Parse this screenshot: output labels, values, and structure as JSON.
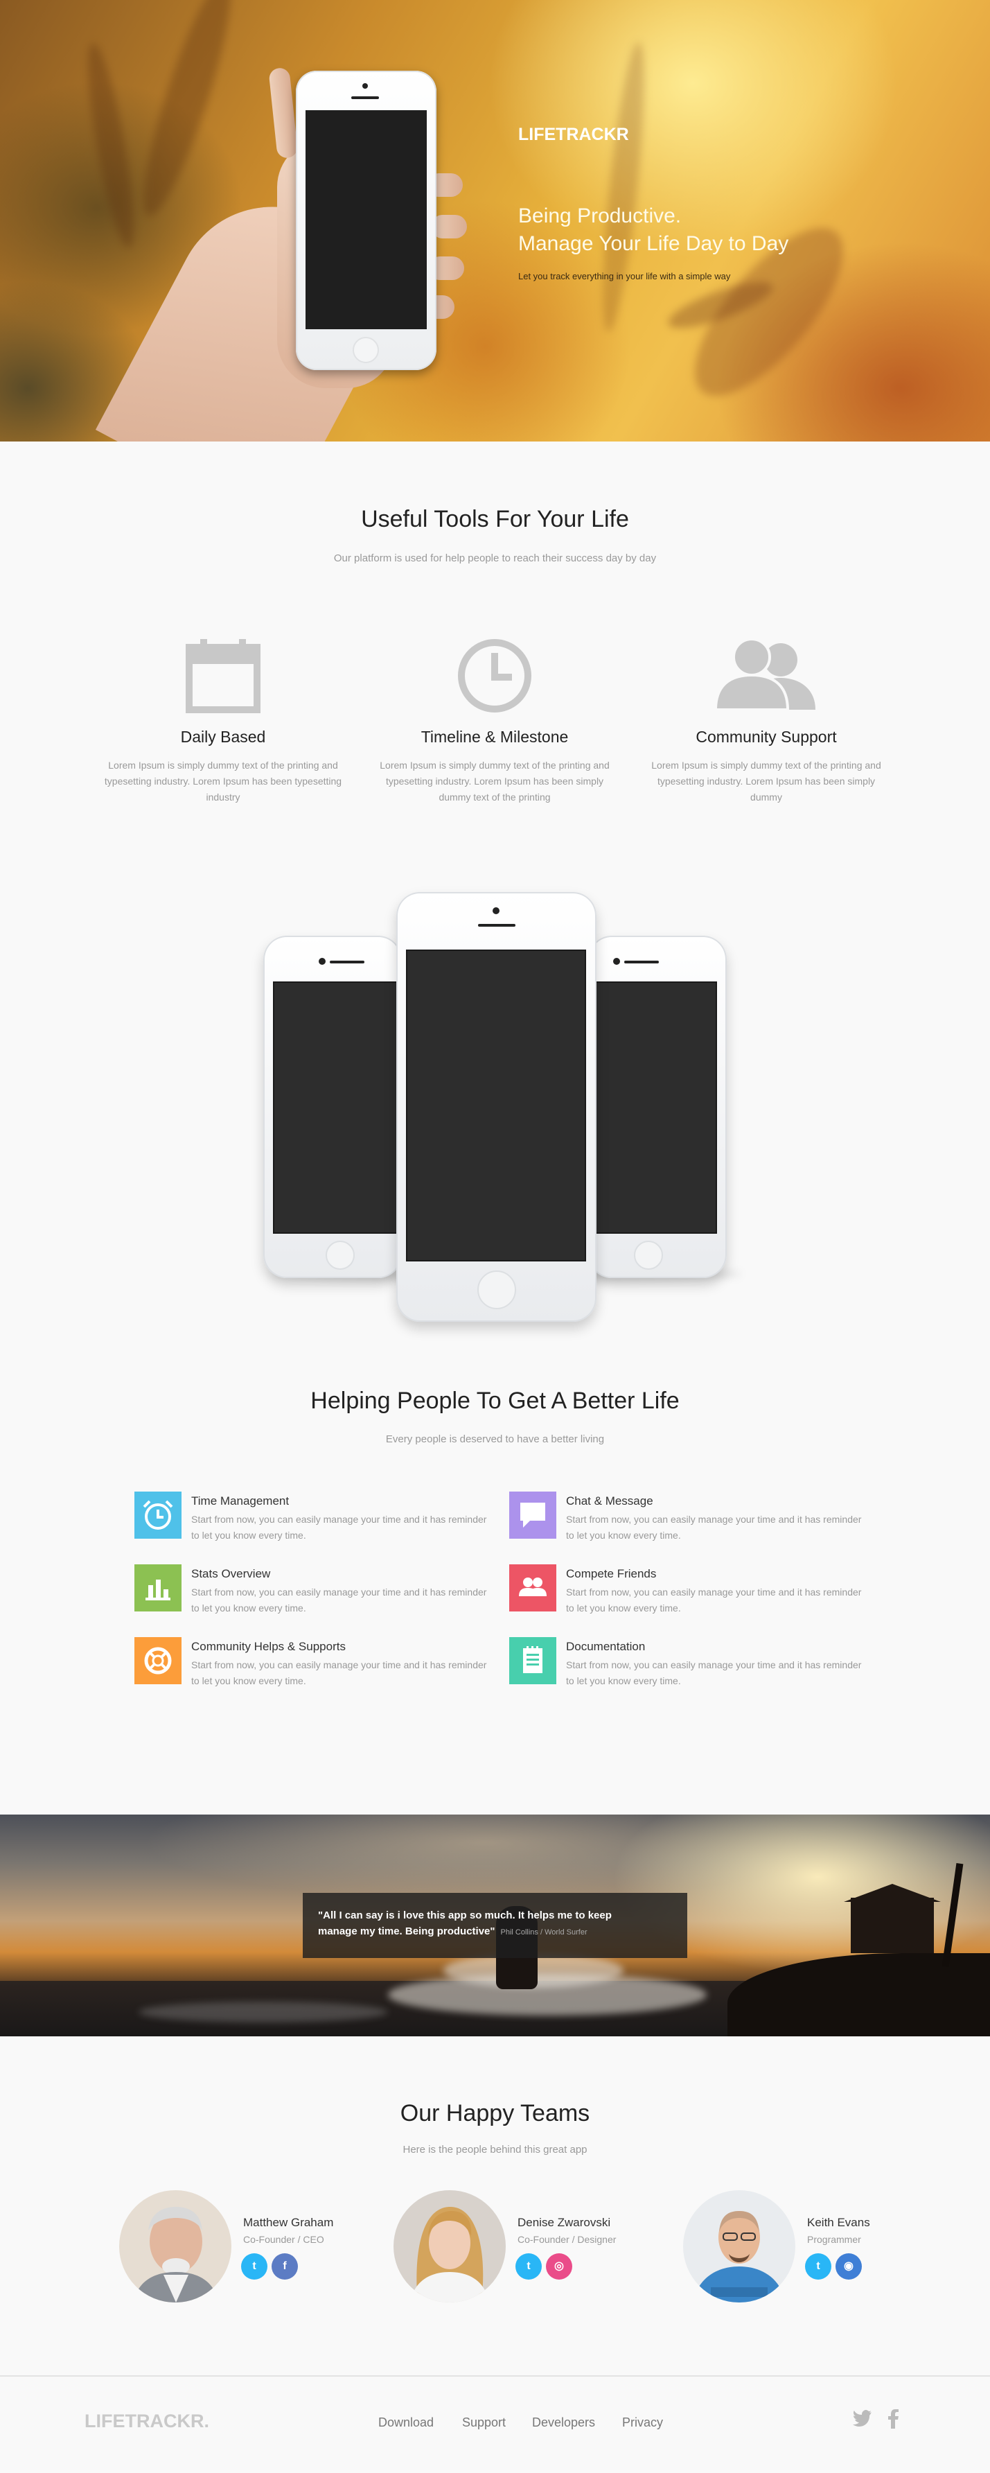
{
  "hero": {
    "logo": "LIFETRACKR",
    "headline_line1": "Being Productive.",
    "headline_line2": "Manage Your Life Day to Day",
    "subtext": "Let you track everything in your life with a simple way"
  },
  "tools": {
    "title": "Useful Tools For Your Life",
    "subtitle": "Our platform is used for help people to reach their success day by day",
    "items": [
      {
        "icon": "calendar-icon",
        "title": "Daily Based",
        "desc": "Lorem Ipsum is simply dummy text of the printing and typesetting industry. Lorem Ipsum has been typesetting industry"
      },
      {
        "icon": "clock-icon",
        "title": "Timeline & Milestone",
        "desc": "Lorem Ipsum is simply dummy text of the printing and typesetting industry. Lorem Ipsum has been simply dummy text of the printing"
      },
      {
        "icon": "users-icon",
        "title": "Community Support",
        "desc": "Lorem Ipsum is simply dummy text of the printing and typesetting industry. Lorem Ipsum has been simply dummy"
      }
    ]
  },
  "features": {
    "title": "Helping People To Get A Better Life",
    "subtitle": "Every people is deserved to have a better living",
    "items": [
      {
        "icon": "alarm-clock-icon",
        "color": "#4fc1e9",
        "title": "Time Management",
        "desc": "Start from now, you can easily manage your time and it has reminder to let you know every time."
      },
      {
        "icon": "chat-icon",
        "color": "#ac92ec",
        "title": "Chat & Message",
        "desc": "Start from now, you can easily manage your time and it has reminder to let you know every time."
      },
      {
        "icon": "bar-chart-icon",
        "color": "#8cc152",
        "title": "Stats Overview",
        "desc": "Start from now, you can easily manage your time and it has reminder to let you know every time."
      },
      {
        "icon": "friends-icon",
        "color": "#ed5565",
        "title": "Compete Friends",
        "desc": "Start from now, you can easily manage your time and it has reminder to let you know every time."
      },
      {
        "icon": "lifebuoy-icon",
        "color": "#fc9d3a",
        "title": "Community Helps & Supports",
        "desc": "Start from now, you can easily manage your time and it has reminder to let you know every time."
      },
      {
        "icon": "document-icon",
        "color": "#48cfad",
        "title": "Documentation",
        "desc": "Start from now, you can easily manage your time and it has reminder to let you know every time."
      }
    ]
  },
  "testimonial": {
    "quote_line1": "\"All I can say is i love this app so much. It helps me to keep",
    "quote_line2": "manage my time. Being productive\"",
    "author": "Phil Collins / World Surfer"
  },
  "team": {
    "title": "Our Happy Teams",
    "subtitle": "Here is the people behind this great app",
    "members": [
      {
        "name": "Matthew Graham",
        "role": "Co-Founder / CEO",
        "social": [
          {
            "icon": "twitter-icon",
            "color": "#29b6f6",
            "glyph": "t"
          },
          {
            "icon": "facebook-icon",
            "color": "#5c7cc4",
            "glyph": "f"
          }
        ]
      },
      {
        "name": "Denise Zwarovski",
        "role": "Co-Founder / Designer",
        "social": [
          {
            "icon": "twitter-icon",
            "color": "#29b6f6",
            "glyph": "t"
          },
          {
            "icon": "dribbble-icon",
            "color": "#ea4c89",
            "glyph": "◎"
          }
        ]
      },
      {
        "name": "Keith Evans",
        "role": "Programmer",
        "social": [
          {
            "icon": "twitter-icon",
            "color": "#29b6f6",
            "glyph": "t"
          },
          {
            "icon": "github-icon",
            "color": "#3f7fd6",
            "glyph": "◉"
          }
        ]
      }
    ]
  },
  "footer": {
    "logo": "LIFETRACKR.",
    "nav": [
      "Download",
      "Support",
      "Developers",
      "Privacy"
    ],
    "social": [
      {
        "icon": "twitter-icon",
        "glyph": "t"
      },
      {
        "icon": "facebook-icon",
        "glyph": "f"
      }
    ]
  }
}
